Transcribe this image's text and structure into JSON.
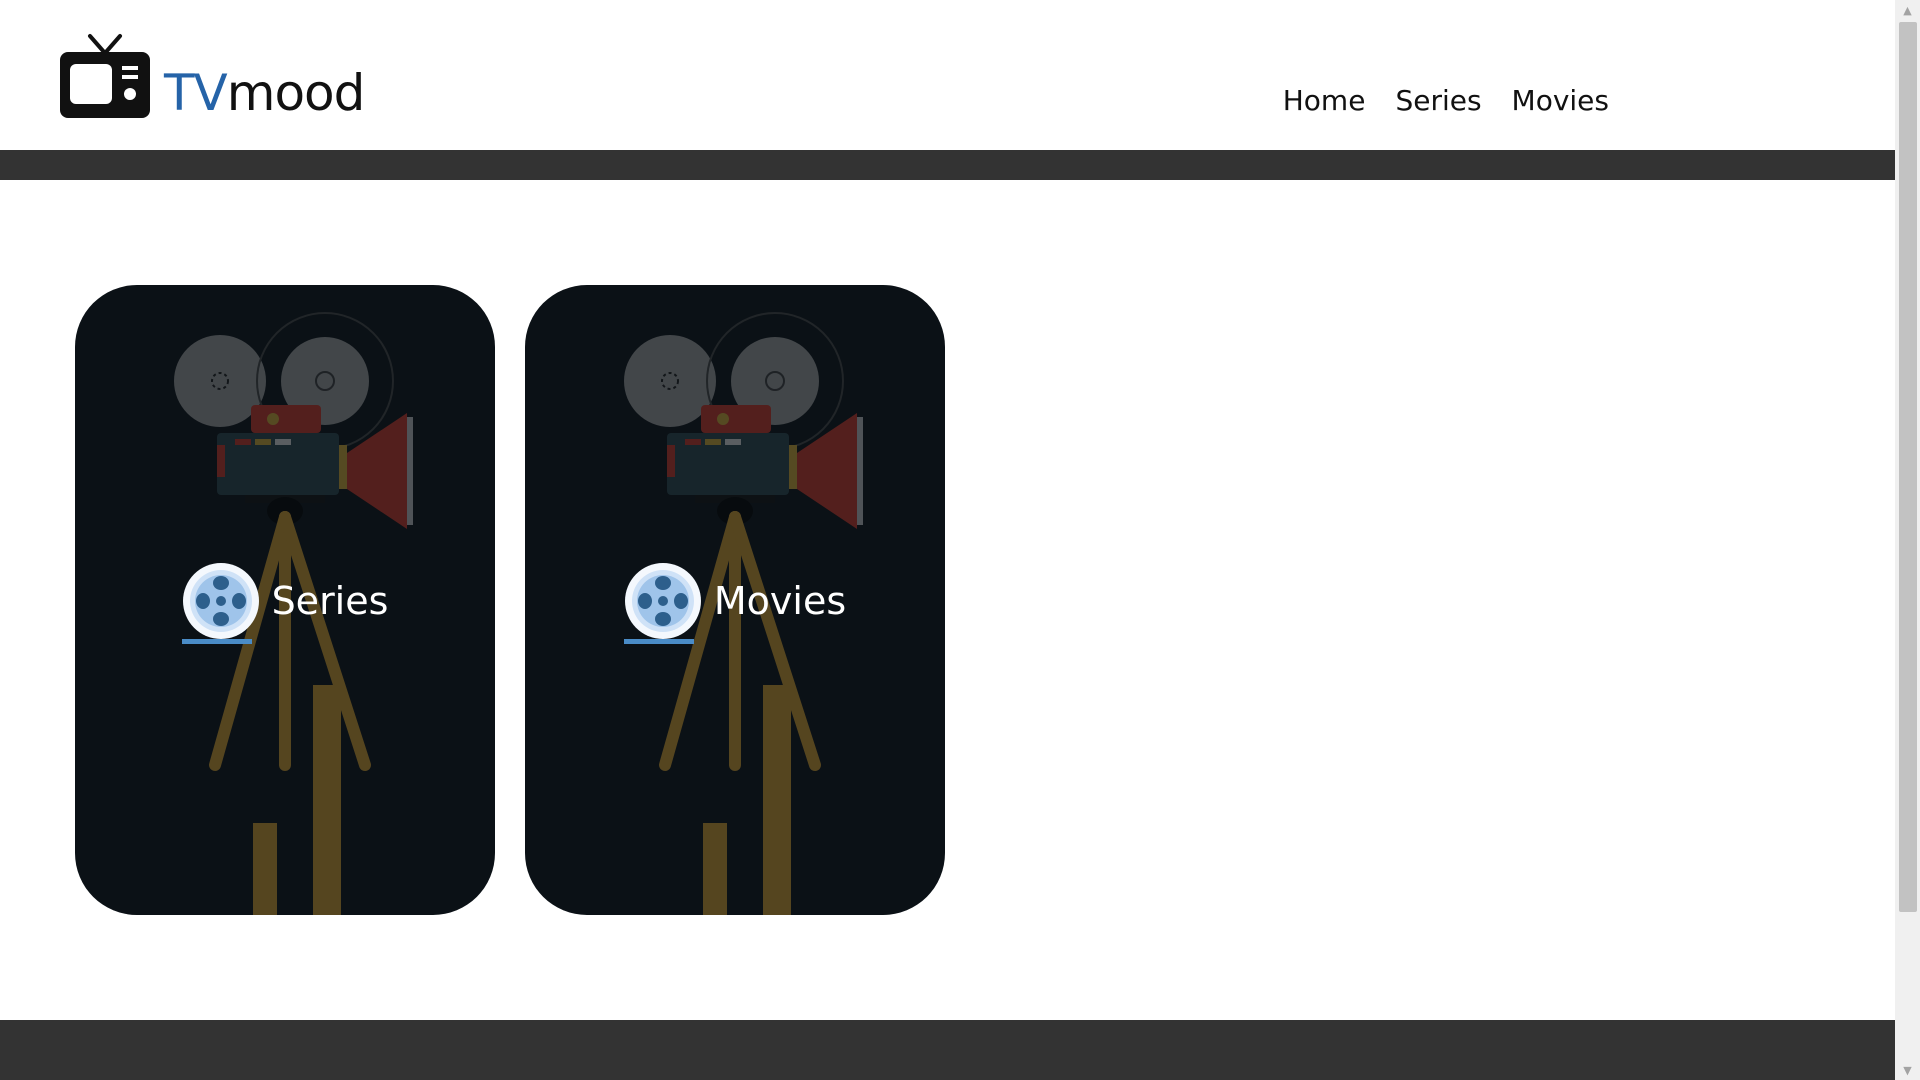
{
  "header": {
    "logo": {
      "text_tv": "TV",
      "text_rest": "mood",
      "icon": "tv-icon",
      "brand_color": "#2563a8"
    },
    "nav": [
      {
        "label": "Home"
      },
      {
        "label": "Series"
      },
      {
        "label": "Movies"
      }
    ]
  },
  "cards": [
    {
      "title": "Series",
      "icon": "film-reel-icon",
      "background": "film-camera-illustration"
    },
    {
      "title": "Movies",
      "icon": "film-reel-icon",
      "background": "film-camera-illustration"
    }
  ],
  "colors": {
    "band": "#333333",
    "card_bg": "#0b1116",
    "accent": "#4a8cc7"
  }
}
